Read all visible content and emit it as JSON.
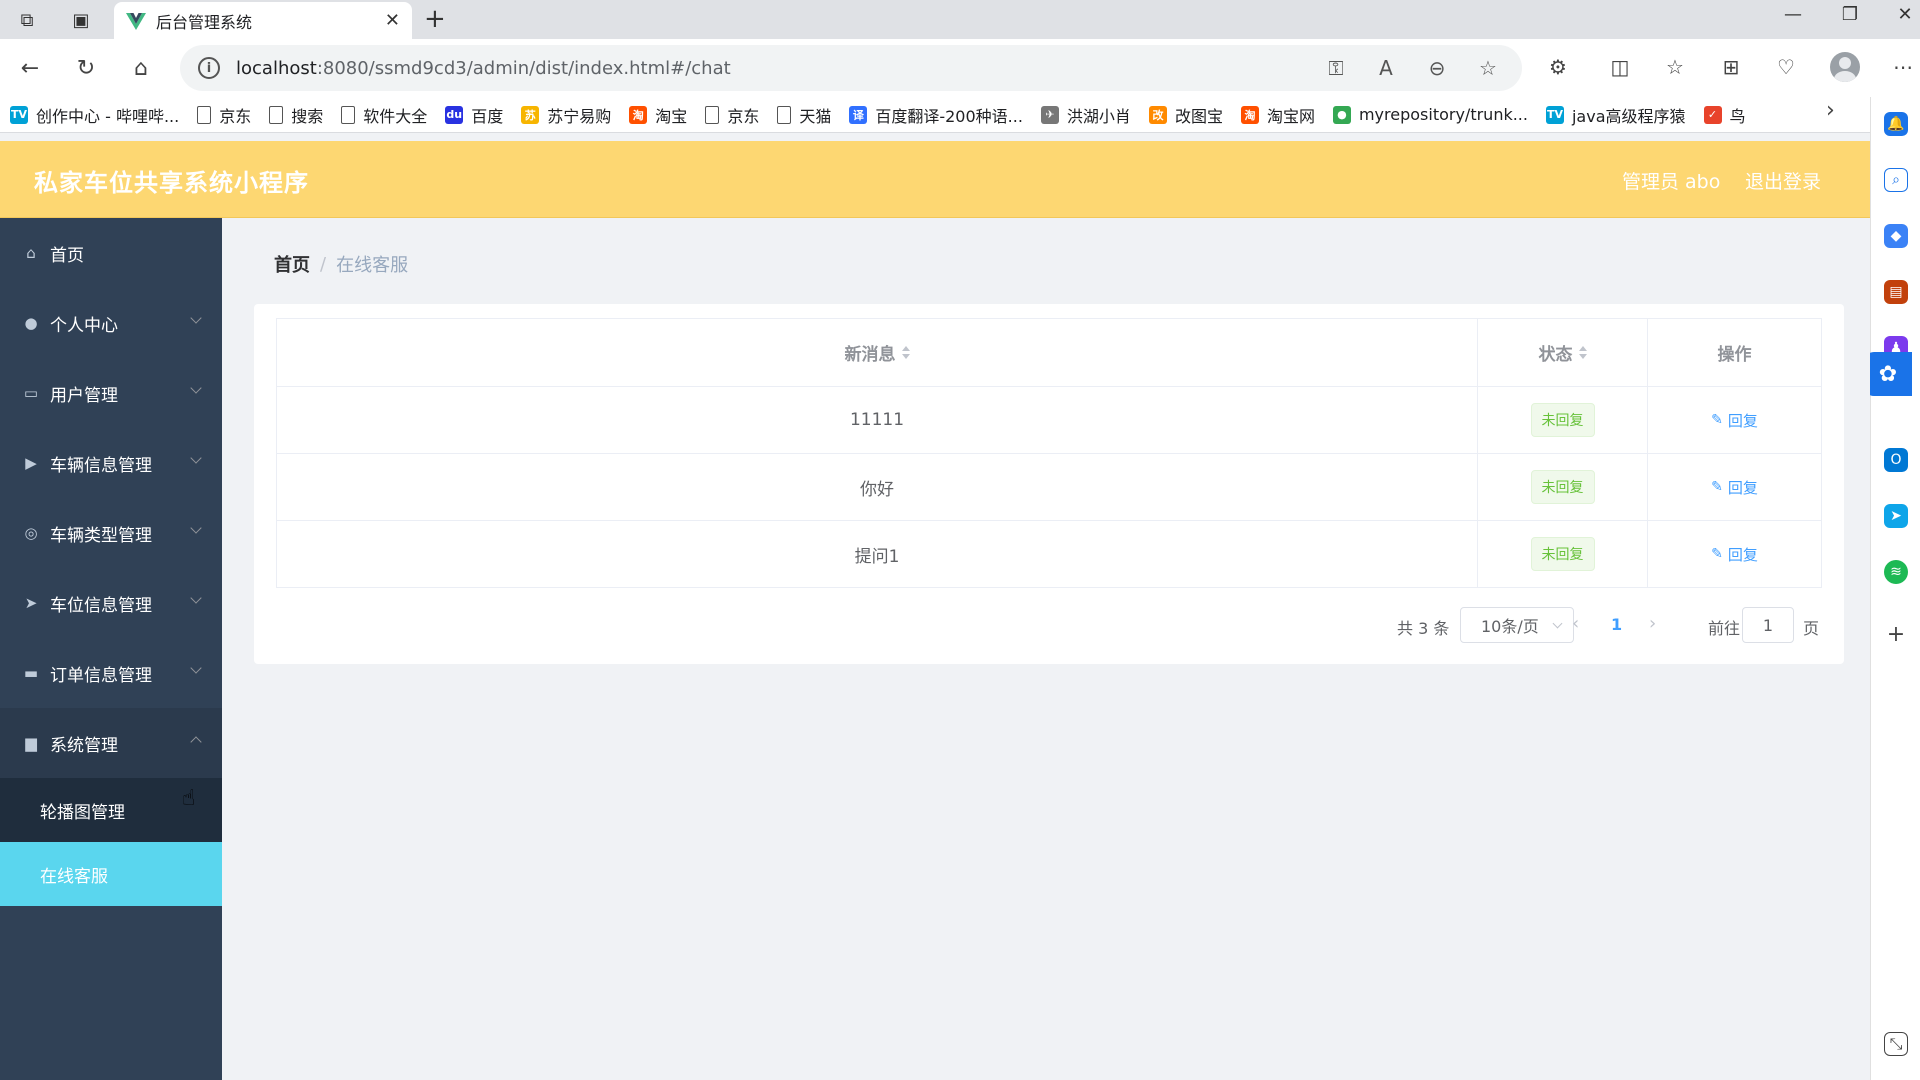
{
  "browser": {
    "tab_title": "后台管理系统",
    "url_host": "localhost",
    "url_path": ":8080/ssmd9cd3/admin/dist/index.html#/chat",
    "bookmarks": [
      {
        "label": "创作中心 - 哔哩哔...",
        "icon": "bilibili-icon",
        "color": "#00a1d6"
      },
      {
        "label": "京东",
        "icon": "page-icon"
      },
      {
        "label": "搜索",
        "icon": "page-icon"
      },
      {
        "label": "软件大全",
        "icon": "page-icon"
      },
      {
        "label": "百度",
        "icon": "baidu-icon",
        "color": "#2932e1"
      },
      {
        "label": "苏宁易购",
        "icon": "suning-icon",
        "color": "#f7b500"
      },
      {
        "label": "淘宝",
        "icon": "taobao-icon",
        "color": "#ff5000"
      },
      {
        "label": "京东",
        "icon": "page-icon"
      },
      {
        "label": "天猫",
        "icon": "page-icon"
      },
      {
        "label": "百度翻译-200种语...",
        "icon": "baidu-translate-icon",
        "color": "#3170ff"
      },
      {
        "label": "洪湖小肖",
        "icon": "wing-icon",
        "color": "#777777"
      },
      {
        "label": "改图宝",
        "icon": "gaitubao-icon",
        "color": "#ff8a00"
      },
      {
        "label": "淘宝网",
        "icon": "taobao-icon",
        "color": "#ff5000"
      },
      {
        "label": "myrepository/trunk...",
        "icon": "chrome-icon",
        "color": "#34a853"
      },
      {
        "label": "java高级程序猿",
        "icon": "bilibili-icon",
        "color": "#00a1d6"
      },
      {
        "label": "鸟",
        "icon": "bird-icon",
        "color": "#e8432b"
      }
    ]
  },
  "app": {
    "title": "私家车位共享系统小程序",
    "user_label": "管理员 abo",
    "logout_label": "退出登录"
  },
  "sidebar": {
    "items": [
      {
        "label": "首页",
        "icon": "home-icon"
      },
      {
        "label": "个人中心",
        "icon": "user-icon"
      },
      {
        "label": "用户管理",
        "icon": "chat-icon"
      },
      {
        "label": "车辆信息管理",
        "icon": "tag-icon"
      },
      {
        "label": "车辆类型管理",
        "icon": "target-icon"
      },
      {
        "label": "车位信息管理",
        "icon": "send-icon"
      },
      {
        "label": "订单信息管理",
        "icon": "printer-icon"
      },
      {
        "label": "系统管理",
        "icon": "suitcase-icon"
      }
    ],
    "sub_items": [
      {
        "label": "轮播图管理"
      },
      {
        "label": "在线客服"
      }
    ]
  },
  "breadcrumb": {
    "home": "首页",
    "separator": "/",
    "current": "在线客服"
  },
  "table": {
    "headers": [
      "新消息",
      "状态",
      "操作"
    ],
    "rows": [
      {
        "message": "11111",
        "status": "未回复",
        "action": "回复"
      },
      {
        "message": "你好",
        "status": "未回复",
        "action": "回复"
      },
      {
        "message": "提问1",
        "status": "未回复",
        "action": "回复"
      }
    ]
  },
  "pagination": {
    "total": "共 3 条",
    "page_size": "10条/页",
    "current_page": "1",
    "goto_label": "前往",
    "goto_value": "1",
    "page_suffix": "页"
  },
  "colors": {
    "header": "#fdd772",
    "sidebar": "#304156",
    "active_sub": "#5ad6ee",
    "status_tag": "#67c23a",
    "link": "#409eff"
  }
}
